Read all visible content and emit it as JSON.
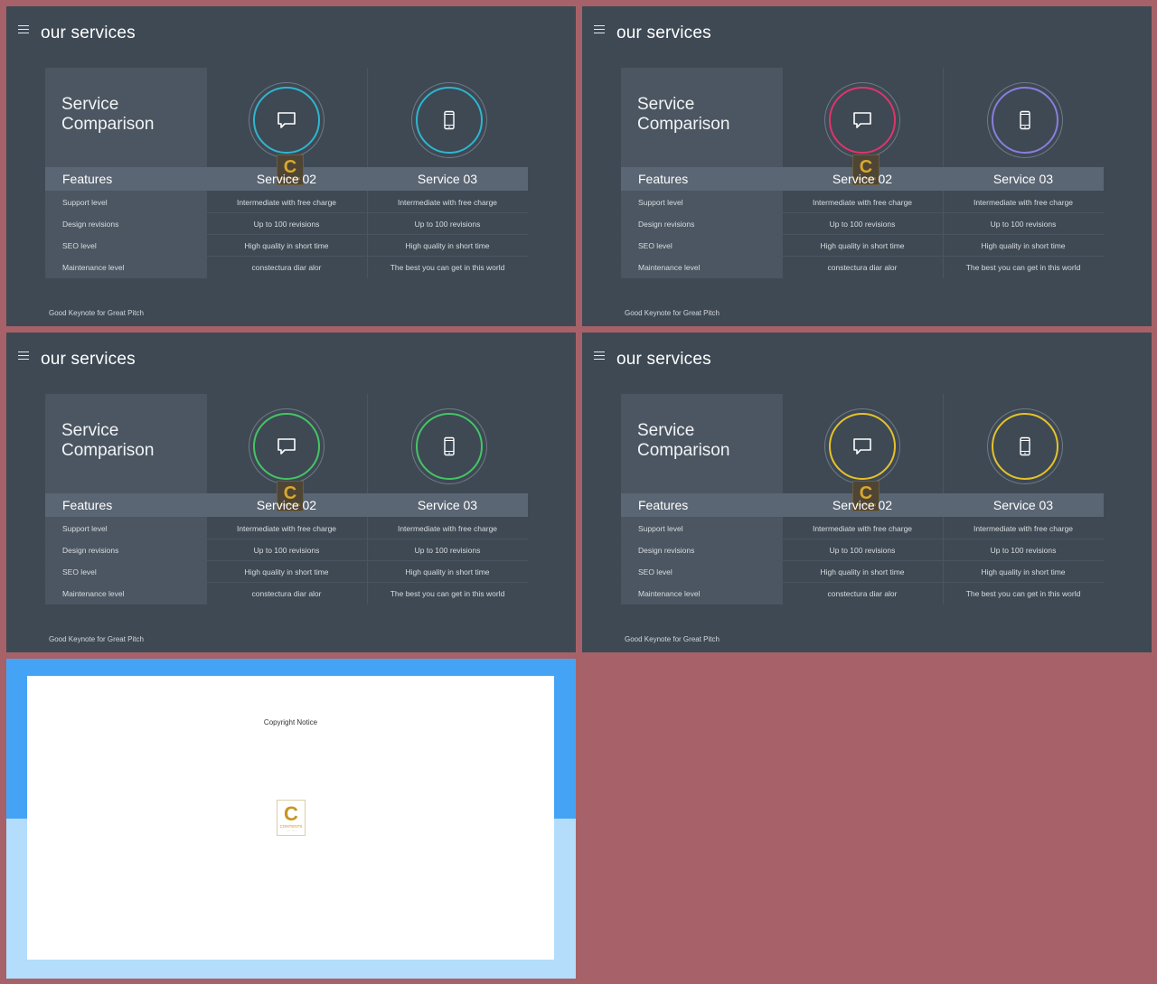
{
  "slides": [
    {
      "title": "our services",
      "comparison_title_line1": "Service",
      "comparison_title_line2": "Comparison",
      "columns": [
        "Features",
        "Service 02",
        "Service 03"
      ],
      "rows": [
        [
          "Support level",
          "Intermediate with free charge",
          "Intermediate with free charge"
        ],
        [
          "Design revisions",
          "Up to 100 revisions",
          "Up to 100 revisions"
        ],
        [
          "SEO level",
          "High quality in short time",
          "High quality in short time"
        ],
        [
          "Maintenance level",
          "constectura diar alor",
          "The best you can get in this world"
        ]
      ],
      "footer": "Good Keynote for Great Pitch",
      "accent_service02": "#2fb5cf",
      "accent_service03": "#2fb5cf",
      "icons": [
        "chat-bubble-icon",
        "mobile-phone-icon"
      ]
    },
    {
      "title": "our services",
      "comparison_title_line1": "Service",
      "comparison_title_line2": "Comparison",
      "columns": [
        "Features",
        "Service 02",
        "Service 03"
      ],
      "rows": [
        [
          "Support level",
          "Intermediate with free charge",
          "Intermediate with free charge"
        ],
        [
          "Design revisions",
          "Up to 100 revisions",
          "Up to 100 revisions"
        ],
        [
          "SEO level",
          "High quality in short time",
          "High quality in short time"
        ],
        [
          "Maintenance level",
          "constectura diar alor",
          "The best you can get in this world"
        ]
      ],
      "footer": "Good Keynote for Great Pitch",
      "accent_service02": "#e0346b",
      "accent_service03": "#8a7ddc",
      "icons": [
        "chat-bubble-icon",
        "mobile-phone-icon"
      ]
    },
    {
      "title": "our services",
      "comparison_title_line1": "Service",
      "comparison_title_line2": "Comparison",
      "columns": [
        "Features",
        "Service 02",
        "Service 03"
      ],
      "rows": [
        [
          "Support level",
          "Intermediate with free charge",
          "Intermediate with free charge"
        ],
        [
          "Design revisions",
          "Up to 100 revisions",
          "Up to 100 revisions"
        ],
        [
          "SEO level",
          "High quality in short time",
          "High quality in short time"
        ],
        [
          "Maintenance level",
          "constectura diar alor",
          "The best you can get in this world"
        ]
      ],
      "footer": "Good Keynote for Great Pitch",
      "accent_service02": "#45c466",
      "accent_service03": "#45c466",
      "icons": [
        "chat-bubble-icon",
        "mobile-phone-icon"
      ]
    },
    {
      "title": "our services",
      "comparison_title_line1": "Service",
      "comparison_title_line2": "Comparison",
      "columns": [
        "Features",
        "Service 02",
        "Service 03"
      ],
      "rows": [
        [
          "Support level",
          "Intermediate with free charge",
          "Intermediate with free charge"
        ],
        [
          "Design revisions",
          "Up to 100 revisions",
          "Up to 100 revisions"
        ],
        [
          "SEO level",
          "High quality in short time",
          "High quality in short time"
        ],
        [
          "Maintenance level",
          "constectura diar alor",
          "The best you can get in this world"
        ]
      ],
      "footer": "Good Keynote for Great Pitch",
      "accent_service02": "#e5c22a",
      "accent_service03": "#e5c22a",
      "icons": [
        "chat-bubble-icon",
        "mobile-phone-icon"
      ]
    }
  ],
  "copyright": {
    "notice": "Copyright Notice",
    "logo_letter": "C",
    "logo_text": "CONTENTS"
  },
  "colors": {
    "background": "#a66268",
    "slide": "#3e4954",
    "copyright_top": "#45a3f6",
    "copyright_bottom": "#b3ddfa"
  }
}
